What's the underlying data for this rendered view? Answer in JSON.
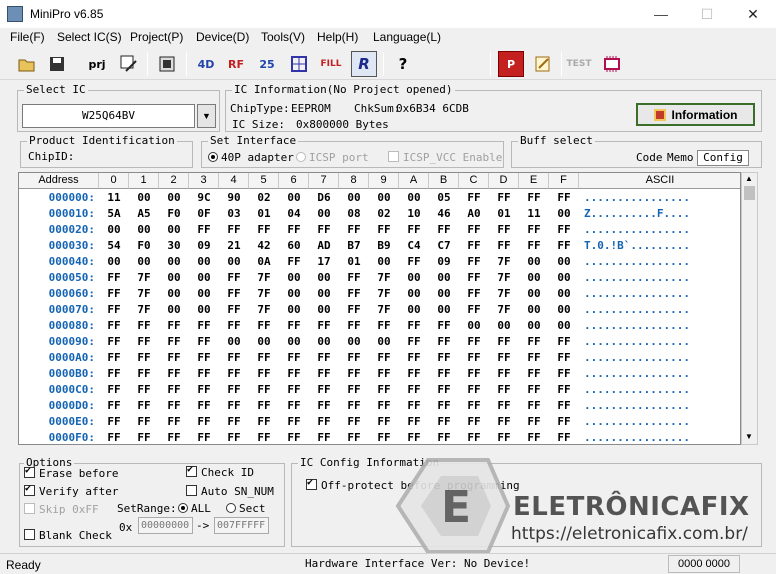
{
  "title": "MiniPro v6.85",
  "window_controls": {
    "minimize": "—",
    "maximize": "☐",
    "close": "✕"
  },
  "menu": [
    "File(F)",
    "Select IC(S)",
    "Project(P)",
    "Device(D)",
    "Tools(V)",
    "Help(H)",
    "Language(L)"
  ],
  "toolbar": {
    "prj": "prj",
    "fill": "FILL",
    "test": "TEST",
    "help": "?"
  },
  "select_ic": {
    "label": "Select IC",
    "value": "W25Q64BV",
    "dropdown": "▼"
  },
  "ic_info": {
    "label": "IC Information(No Project opened)",
    "chip_type_label": "ChipType:",
    "chip_type": "EEPROM",
    "chksum_label": "ChkSum:",
    "chksum": "0x6B34 6CDB",
    "size_label": "IC Size:",
    "size": "0x800000 Bytes",
    "button": "Information"
  },
  "product_id": {
    "label": "Product Identification",
    "chip_id_label": "ChipID:"
  },
  "interface": {
    "label": "Set Interface",
    "opt1": "40P adapter",
    "opt2": "ICSP port",
    "opt3": "ICSP_VCC Enable"
  },
  "buff": {
    "label": "Buff select",
    "code": "Code",
    "memo": "Memo",
    "config": "Config"
  },
  "grid": {
    "address_header": "Address",
    "ascii_header": "ASCII",
    "columns": [
      "0",
      "1",
      "2",
      "3",
      "4",
      "5",
      "6",
      "7",
      "8",
      "9",
      "A",
      "B",
      "C",
      "D",
      "E",
      "F"
    ],
    "rows": [
      {
        "addr": "000000:",
        "bytes": [
          "11",
          "00",
          "00",
          "9C",
          "90",
          "02",
          "00",
          "D6",
          "00",
          "00",
          "00",
          "05",
          "FF",
          "FF",
          "FF",
          "FF"
        ],
        "ascii": "................"
      },
      {
        "addr": "000010:",
        "bytes": [
          "5A",
          "A5",
          "F0",
          "0F",
          "03",
          "01",
          "04",
          "00",
          "08",
          "02",
          "10",
          "46",
          "A0",
          "01",
          "11",
          "00"
        ],
        "ascii": "Z..........F...."
      },
      {
        "addr": "000020:",
        "bytes": [
          "00",
          "00",
          "00",
          "FF",
          "FF",
          "FF",
          "FF",
          "FF",
          "FF",
          "FF",
          "FF",
          "FF",
          "FF",
          "FF",
          "FF",
          "FF"
        ],
        "ascii": "................"
      },
      {
        "addr": "000030:",
        "bytes": [
          "54",
          "F0",
          "30",
          "09",
          "21",
          "42",
          "60",
          "AD",
          "B7",
          "B9",
          "C4",
          "C7",
          "FF",
          "FF",
          "FF",
          "FF"
        ],
        "ascii": "T.0.!B`........."
      },
      {
        "addr": "000040:",
        "bytes": [
          "00",
          "00",
          "00",
          "00",
          "00",
          "0A",
          "FF",
          "17",
          "01",
          "00",
          "FF",
          "09",
          "FF",
          "7F",
          "00",
          "00"
        ],
        "ascii": "................"
      },
      {
        "addr": "000050:",
        "bytes": [
          "FF",
          "7F",
          "00",
          "00",
          "FF",
          "7F",
          "00",
          "00",
          "FF",
          "7F",
          "00",
          "00",
          "FF",
          "7F",
          "00",
          "00"
        ],
        "ascii": "................"
      },
      {
        "addr": "000060:",
        "bytes": [
          "FF",
          "7F",
          "00",
          "00",
          "FF",
          "7F",
          "00",
          "00",
          "FF",
          "7F",
          "00",
          "00",
          "FF",
          "7F",
          "00",
          "00"
        ],
        "ascii": "................"
      },
      {
        "addr": "000070:",
        "bytes": [
          "FF",
          "7F",
          "00",
          "00",
          "FF",
          "7F",
          "00",
          "00",
          "FF",
          "7F",
          "00",
          "00",
          "FF",
          "7F",
          "00",
          "00"
        ],
        "ascii": "................"
      },
      {
        "addr": "000080:",
        "bytes": [
          "FF",
          "FF",
          "FF",
          "FF",
          "FF",
          "FF",
          "FF",
          "FF",
          "FF",
          "FF",
          "FF",
          "FF",
          "00",
          "00",
          "00",
          "00"
        ],
        "ascii": "................"
      },
      {
        "addr": "000090:",
        "bytes": [
          "FF",
          "FF",
          "FF",
          "FF",
          "00",
          "00",
          "00",
          "00",
          "00",
          "00",
          "FF",
          "FF",
          "FF",
          "FF",
          "FF",
          "FF"
        ],
        "ascii": "................"
      },
      {
        "addr": "0000A0:",
        "bytes": [
          "FF",
          "FF",
          "FF",
          "FF",
          "FF",
          "FF",
          "FF",
          "FF",
          "FF",
          "FF",
          "FF",
          "FF",
          "FF",
          "FF",
          "FF",
          "FF"
        ],
        "ascii": "................"
      },
      {
        "addr": "0000B0:",
        "bytes": [
          "FF",
          "FF",
          "FF",
          "FF",
          "FF",
          "FF",
          "FF",
          "FF",
          "FF",
          "FF",
          "FF",
          "FF",
          "FF",
          "FF",
          "FF",
          "FF"
        ],
        "ascii": "................"
      },
      {
        "addr": "0000C0:",
        "bytes": [
          "FF",
          "FF",
          "FF",
          "FF",
          "FF",
          "FF",
          "FF",
          "FF",
          "FF",
          "FF",
          "FF",
          "FF",
          "FF",
          "FF",
          "FF",
          "FF"
        ],
        "ascii": "................"
      },
      {
        "addr": "0000D0:",
        "bytes": [
          "FF",
          "FF",
          "FF",
          "FF",
          "FF",
          "FF",
          "FF",
          "FF",
          "FF",
          "FF",
          "FF",
          "FF",
          "FF",
          "FF",
          "FF",
          "FF"
        ],
        "ascii": "................"
      },
      {
        "addr": "0000E0:",
        "bytes": [
          "FF",
          "FF",
          "FF",
          "FF",
          "FF",
          "FF",
          "FF",
          "FF",
          "FF",
          "FF",
          "FF",
          "FF",
          "FF",
          "FF",
          "FF",
          "FF"
        ],
        "ascii": "................"
      },
      {
        "addr": "0000F0:",
        "bytes": [
          "FF",
          "FF",
          "FF",
          "FF",
          "FF",
          "FF",
          "FF",
          "FF",
          "FF",
          "FF",
          "FF",
          "FF",
          "FF",
          "FF",
          "FF",
          "FF"
        ],
        "ascii": "................"
      }
    ]
  },
  "options": {
    "label": "Options",
    "erase": "Erase before",
    "verify": "Verify after",
    "skip": "Skip 0xFF",
    "blank": "Blank Check",
    "check_id": "Check ID",
    "auto_sn": "Auto SN_NUM",
    "setrange": "SetRange:",
    "all": "ALL",
    "sect": "Sect",
    "ox": "0x",
    "from": "00000000",
    "arrow": "->",
    "to": "007FFFFF"
  },
  "ic_config": {
    "label": "IC Config Information",
    "off_protect": "Off-protect before programming"
  },
  "status": {
    "ready": "Ready",
    "hardware": "Hardware Interface Ver: No Device!",
    "counter": "0000 0000"
  },
  "watermark": {
    "brand": "ELETRÔNICAFIX",
    "url": "https://eletronicafix.com.br/"
  }
}
